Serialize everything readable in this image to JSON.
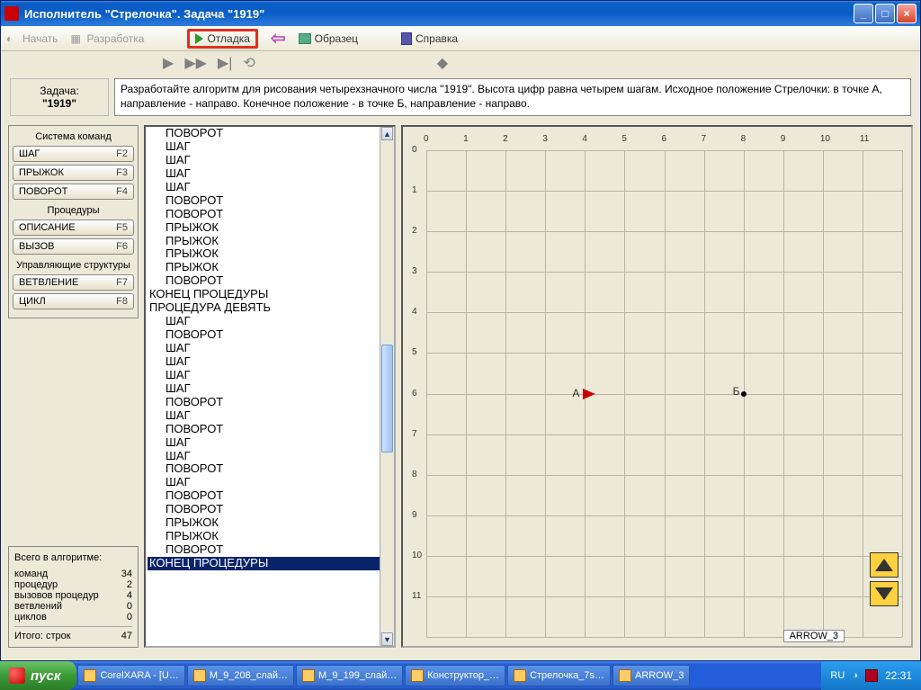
{
  "titlebar": {
    "title": "Исполнитель \"Стрелочка\".   Задача  \"1919\""
  },
  "menubar": {
    "start": "Начать",
    "develop": "Разработка",
    "debug": "Отладка",
    "sample": "Образец",
    "help": "Справка"
  },
  "task": {
    "label": "Задача:",
    "value": "\"1919\"",
    "description": "Разработайте алгоритм для рисования четырехзначного числа \"1919\". Высота цифр равна четырем шагам. Исходное положение Стрелочки: в точке А, направление - направо. Конечное положение - в  точке Б, направление - направо."
  },
  "sidebar": {
    "system_title": "Система команд",
    "cmds": [
      {
        "label": "ШАГ",
        "hk": "F2"
      },
      {
        "label": "ПРЫЖОК",
        "hk": "F3"
      },
      {
        "label": "ПОВОРОТ",
        "hk": "F4"
      }
    ],
    "proc_title": "Процедуры",
    "procs": [
      {
        "label": "ОПИСАНИЕ",
        "hk": "F5"
      },
      {
        "label": "ВЫЗОВ",
        "hk": "F6"
      }
    ],
    "ctrl_title": "Управляющие структуры",
    "ctrls": [
      {
        "label": "ВЕТВЛЕНИЕ",
        "hk": "F7"
      },
      {
        "label": "ЦИКЛ",
        "hk": "F8"
      }
    ]
  },
  "stats": {
    "title": "Всего в алгоритме:",
    "rows": [
      {
        "k": "команд",
        "v": "34"
      },
      {
        "k": "процедур",
        "v": "2"
      },
      {
        "k": "вызовов процедур",
        "v": "4"
      },
      {
        "k": "ветвлений",
        "v": "0"
      },
      {
        "k": "циклов",
        "v": "0"
      }
    ],
    "total_k": "Итого:  строк",
    "total_v": "47"
  },
  "code": [
    {
      "t": "ПОВОРОТ",
      "i": 1
    },
    {
      "t": "ШАГ",
      "i": 1
    },
    {
      "t": "ШАГ",
      "i": 1
    },
    {
      "t": "ШАГ",
      "i": 1
    },
    {
      "t": "ШАГ",
      "i": 1
    },
    {
      "t": "ПОВОРОТ",
      "i": 1
    },
    {
      "t": "ПОВОРОТ",
      "i": 1
    },
    {
      "t": "ПРЫЖОК",
      "i": 1
    },
    {
      "t": "ПРЫЖОК",
      "i": 1
    },
    {
      "t": "ПРЫЖОК",
      "i": 1
    },
    {
      "t": "ПРЫЖОК",
      "i": 1
    },
    {
      "t": "ПОВОРОТ",
      "i": 1
    },
    {
      "t": "КОНЕЦ ПРОЦЕДУРЫ",
      "i": 0
    },
    {
      "t": "ПРОЦЕДУРА ДЕВЯТЬ",
      "i": 0
    },
    {
      "t": "ШАГ",
      "i": 1
    },
    {
      "t": "ПОВОРОТ",
      "i": 1
    },
    {
      "t": "ШАГ",
      "i": 1
    },
    {
      "t": "ШАГ",
      "i": 1
    },
    {
      "t": "ШАГ",
      "i": 1
    },
    {
      "t": "ШАГ",
      "i": 1
    },
    {
      "t": "ПОВОРОТ",
      "i": 1
    },
    {
      "t": "ШАГ",
      "i": 1
    },
    {
      "t": "ПОВОРОТ",
      "i": 1
    },
    {
      "t": "ШАГ",
      "i": 1
    },
    {
      "t": "ШАГ",
      "i": 1
    },
    {
      "t": "ПОВОРОТ",
      "i": 1
    },
    {
      "t": "ШАГ",
      "i": 1
    },
    {
      "t": "ПОВОРОТ",
      "i": 1
    },
    {
      "t": "ПОВОРОТ",
      "i": 1
    },
    {
      "t": "ПРЫЖОК",
      "i": 1
    },
    {
      "t": "ПРЫЖОК",
      "i": 1
    },
    {
      "t": "ПОВОРОТ",
      "i": 1
    },
    {
      "t": "КОНЕЦ ПРОЦЕДУРЫ",
      "i": 0,
      "sel": true
    }
  ],
  "grid": {
    "cols": 12,
    "rows": 12,
    "pointA": {
      "label": "А",
      "col": 4,
      "row": 6
    },
    "pointB": {
      "label": "Б",
      "col": 8,
      "row": 6
    },
    "status": "ARROW_3"
  },
  "taskbar": {
    "start": "пуск",
    "items": [
      "CorelXARA - [U…",
      "М_9_208_слай…",
      "М_9_199_слай…",
      "Конструктор_…",
      "Стрелочка_7s…",
      "ARROW_3"
    ],
    "lang": "RU",
    "time": "22:31"
  }
}
